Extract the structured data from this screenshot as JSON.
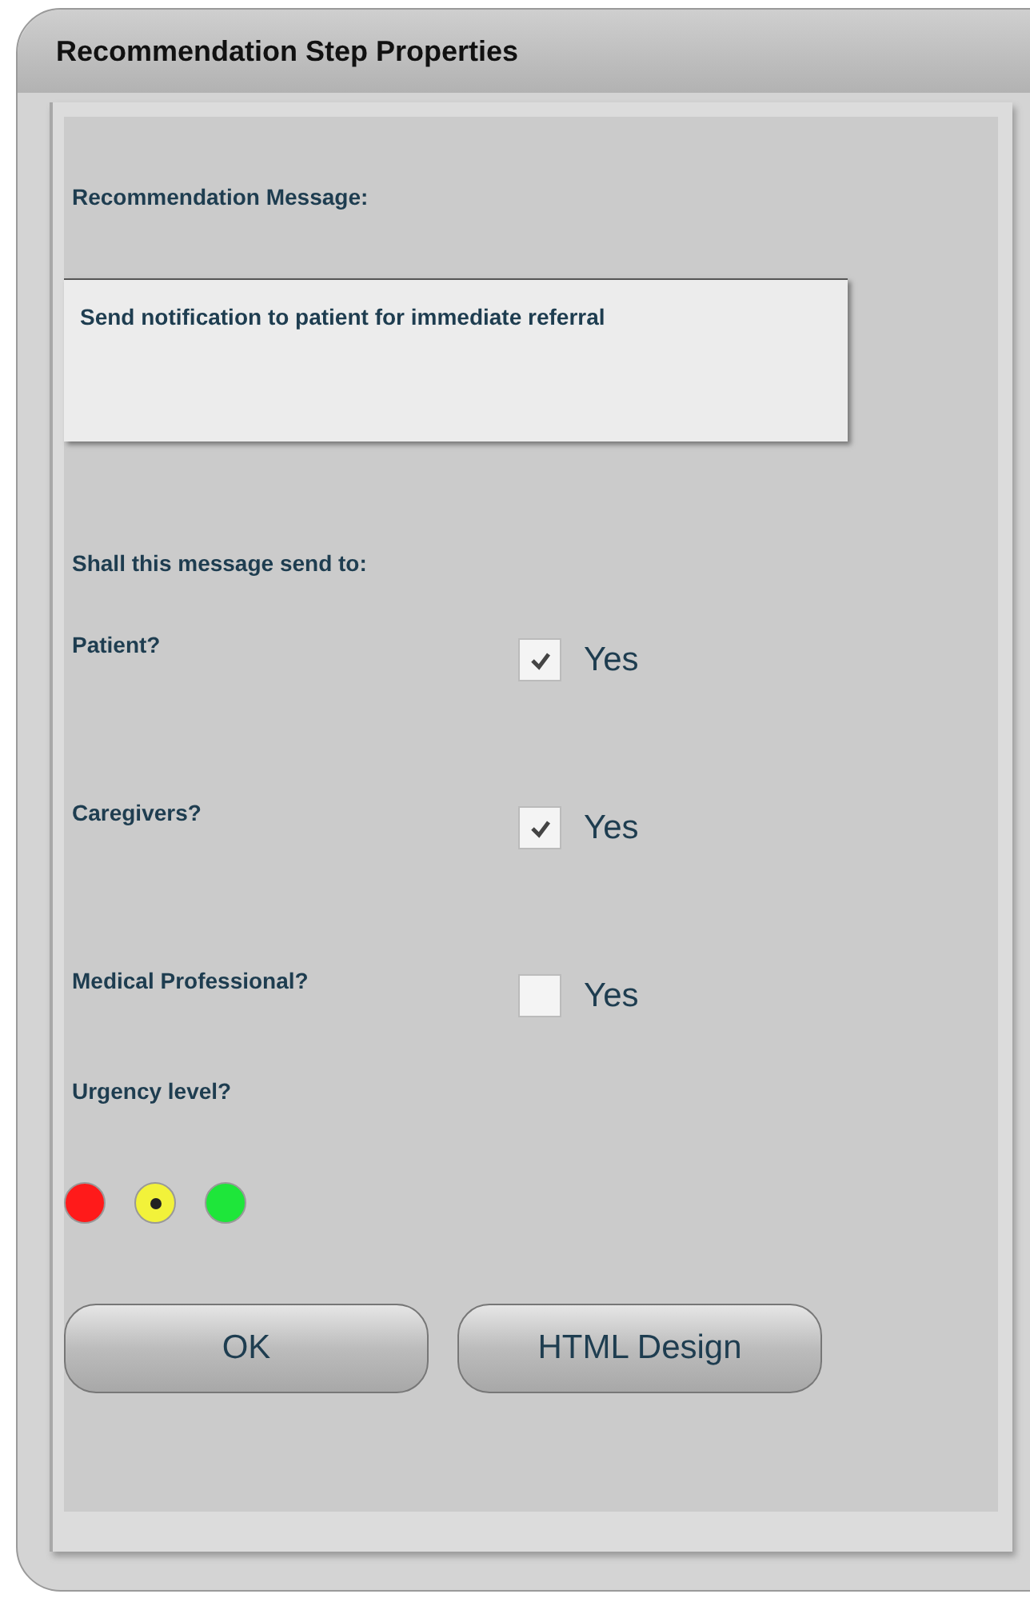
{
  "window": {
    "title": "Recommendation Step Properties"
  },
  "message": {
    "label": "Recommendation Message:",
    "value": "Send notification to patient for immediate referral"
  },
  "recipients": {
    "heading": "Shall this message send to:",
    "items": [
      {
        "label": "Patient?",
        "option": "Yes",
        "checked": true
      },
      {
        "label": "Caregivers?",
        "option": "Yes",
        "checked": true
      },
      {
        "label": "Medical Professional?",
        "option": "Yes",
        "checked": false
      }
    ]
  },
  "urgency": {
    "label": "Urgency level?",
    "options": [
      {
        "color": "#ff1a1a",
        "selected": false
      },
      {
        "color": "#f2f23a",
        "selected": true
      },
      {
        "color": "#1ee63a",
        "selected": false
      }
    ]
  },
  "buttons": [
    "OK",
    "HTML Design"
  ]
}
